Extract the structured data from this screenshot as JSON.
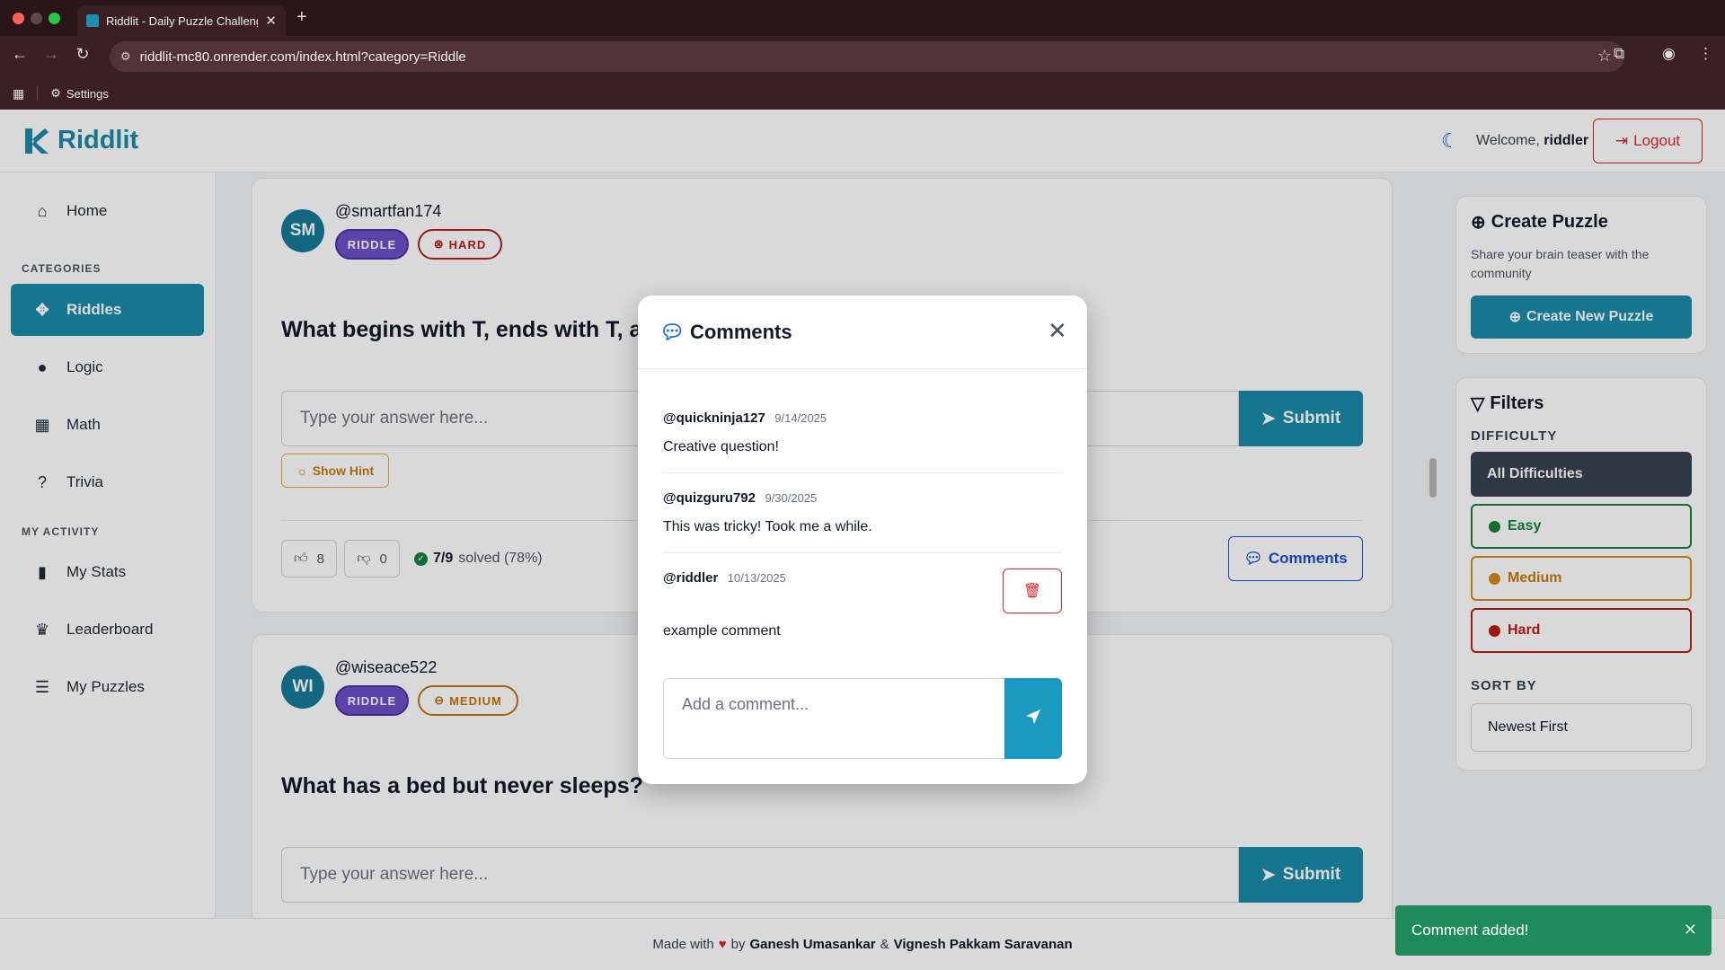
{
  "browser": {
    "tab_title": "Riddlit - Daily Puzzle Challenge",
    "url": "riddlit-mc80.onrender.com/index.html?category=Riddle",
    "bookmark": "Settings"
  },
  "header": {
    "logo_text": "Riddlit",
    "welcome_prefix": "Welcome,",
    "username": "riddler",
    "logout_label": "Logout"
  },
  "sidebar": {
    "home": "Home",
    "categories_heading": "CATEGORIES",
    "categories": [
      {
        "label": "Riddles",
        "icon": "puzzle-icon",
        "active": true
      },
      {
        "label": "Logic",
        "icon": "bulb-icon",
        "active": false
      },
      {
        "label": "Math",
        "icon": "calculator-icon",
        "active": false
      },
      {
        "label": "Trivia",
        "icon": "question-icon",
        "active": false
      }
    ],
    "activity_heading": "MY ACTIVITY",
    "activity": [
      {
        "label": "My Stats",
        "icon": "bar-chart-icon"
      },
      {
        "label": "Leaderboard",
        "icon": "trophy-icon"
      },
      {
        "label": "My Puzzles",
        "icon": "list-icon"
      }
    ]
  },
  "puzzles": [
    {
      "initials": "SM",
      "username": "@smartfan174",
      "category": "RIDDLE",
      "difficulty": "HARD",
      "question": "What begins with T, ends with T, and",
      "answer_placeholder": "Type your answer here...",
      "submit": "Submit",
      "hint": "Show Hint",
      "upvotes": "8",
      "downvotes": "0",
      "solved_count": "7/9",
      "solved_text": "solved (78%)",
      "comments_label": "Comments"
    },
    {
      "initials": "WI",
      "username": "@wiseace522",
      "category": "RIDDLE",
      "difficulty": "MEDIUM",
      "question": "What has a bed but never sleeps?",
      "answer_placeholder": "Type your answer here...",
      "submit": "Submit"
    }
  ],
  "create_panel": {
    "title": "Create Puzzle",
    "subtitle": "Share your brain teaser with the community",
    "button": "Create New Puzzle"
  },
  "filters": {
    "title": "Filters",
    "difficulty_heading": "DIFFICULTY",
    "options": [
      "All Difficulties",
      "Easy",
      "Medium",
      "Hard"
    ],
    "sort_heading": "SORT BY",
    "sort_value": "Newest First"
  },
  "footer": {
    "made_with": "Made with",
    "by": "by",
    "author1": "Ganesh Umasankar",
    "and": "&",
    "author2": "Vignesh Pakkam Saravanan"
  },
  "modal": {
    "title": "Comments",
    "comments": [
      {
        "user": "@quickninja127",
        "date": "9/14/2025",
        "text": "Creative question!"
      },
      {
        "user": "@quizguru792",
        "date": "9/30/2025",
        "text": "This was tricky! Took me a while."
      },
      {
        "user": "@riddler",
        "date": "10/13/2025",
        "text": "example comment"
      }
    ],
    "input_placeholder": "Add a comment..."
  },
  "toast": {
    "message": "Comment added!"
  },
  "colors": {
    "brand": "#1a8aa8",
    "easy": "#15803d",
    "medium": "#c27c0e",
    "hard": "#b91c1c",
    "riddle_badge": "#6d4fc7"
  }
}
